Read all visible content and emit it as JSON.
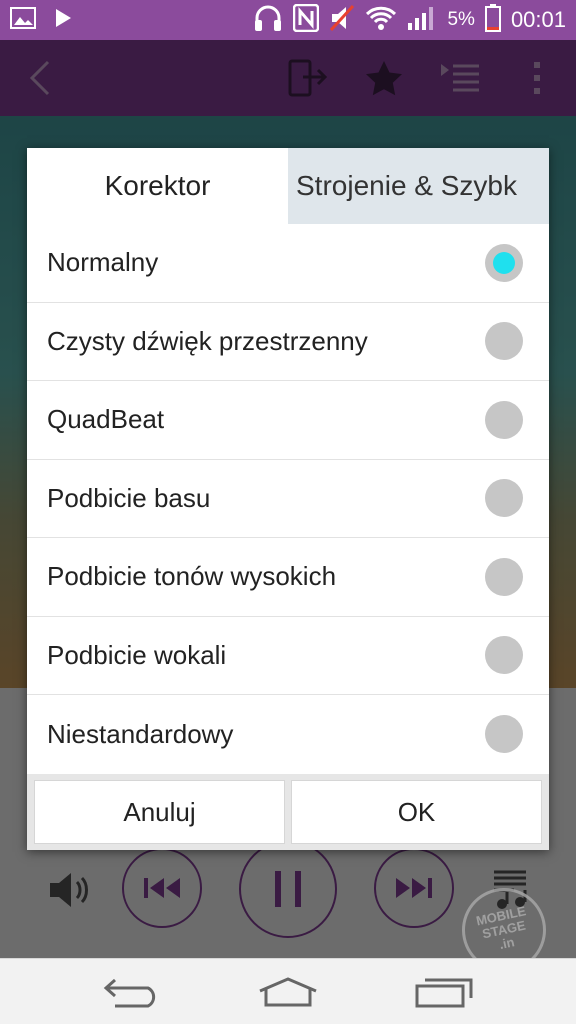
{
  "status_bar": {
    "battery_percent": "5%",
    "time": "00:01",
    "icons": [
      "image-icon",
      "play-icon",
      "headphones-icon",
      "nfc-icon",
      "mute-icon",
      "wifi-icon",
      "signal-icon",
      "battery-icon"
    ]
  },
  "app_bar": {
    "icons": [
      "back-icon",
      "share-output-icon",
      "star-icon",
      "playlist-icon",
      "more-icon"
    ]
  },
  "dialog": {
    "tabs": [
      {
        "label": "Korektor",
        "active": true
      },
      {
        "label": "Strojenie & Szybk",
        "active": false
      }
    ],
    "options": [
      {
        "label": "Normalny",
        "selected": true
      },
      {
        "label": "Czysty dźwięk przestrzenny",
        "selected": false
      },
      {
        "label": "QuadBeat",
        "selected": false
      },
      {
        "label": "Podbicie basu",
        "selected": false
      },
      {
        "label": "Podbicie tonów wysokich",
        "selected": false
      },
      {
        "label": "Podbicie wokali",
        "selected": false
      },
      {
        "label": "Niestandardowy",
        "selected": false
      }
    ],
    "cancel_label": "Anuluj",
    "ok_label": "OK"
  },
  "watermark": {
    "line1": "MOBILE",
    "line2": "STAGE",
    "line3": ".in"
  },
  "colors": {
    "status_bar": "#8b4b9c",
    "app_bar": "#5a2a68",
    "radio_selected": "#1fe0ee"
  }
}
